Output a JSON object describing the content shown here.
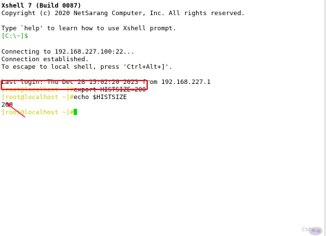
{
  "terminal": {
    "header": {
      "title": "Xshell 7 (Build 0087)",
      "copyright": "Copyright (c) 2020 NetSarang Computer, Inc. All rights reserved."
    },
    "help_line": "Type `help' to learn how to use Xshell prompt.",
    "local_prompt": "[C:\\~]$",
    "connect_lines": [
      "Connecting to 192.168.227.100:22...",
      "Connection established.",
      "To escape to local shell, press 'Ctrl+Alt+]'."
    ],
    "last_login": "Last login: Thu Dec 28 15:02:20 2023 from 192.168.227.1",
    "commands": [
      {
        "prompt": "[root@localhost ~]#",
        "command": "export HISTSIZE=200"
      },
      {
        "prompt": "[root@localhost ~]#",
        "command": "echo $HISTSIZE"
      }
    ],
    "output": "200",
    "final_prompt": "[root@localhost ~]#"
  },
  "watermark": {
    "text": "CSDN @"
  },
  "colors": {
    "prompt_local": "#1a9c1a",
    "prompt_remote": "#c9c904",
    "cursor": "#00e000",
    "annotation": "#e0202a"
  }
}
